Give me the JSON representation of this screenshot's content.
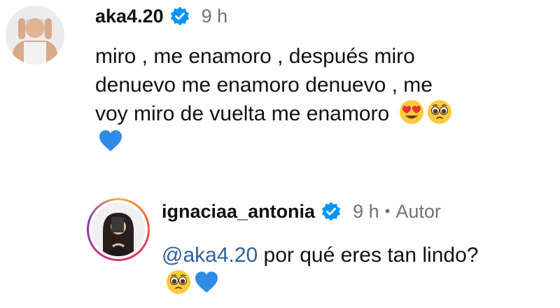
{
  "comments": [
    {
      "username": "aka4.20",
      "time": "9 h",
      "lines": [
        "miro , me enamoro , después miro",
        "denuevo me enamoro denuevo , me",
        "voy miro de vuelta me enamoro"
      ],
      "emojis": [
        "heart-eyes-emoji",
        "pleading-face-emoji",
        "blue-heart-emoji"
      ]
    },
    {
      "username": "ignaciaa_antonia",
      "time": "9 h",
      "separator": "•",
      "badge": "Autor",
      "mention": "@aka4.20",
      "text": " por qué eres tan lindo?",
      "emojis": [
        "pleading-face-emoji",
        "blue-heart-emoji"
      ]
    }
  ],
  "colors": {
    "verified": "#0095f6",
    "mention": "#2f5f9e",
    "meta": "#737373"
  }
}
